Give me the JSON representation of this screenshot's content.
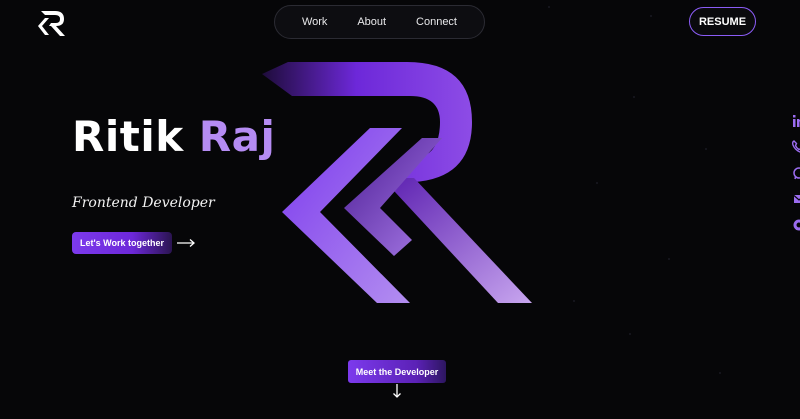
{
  "nav": {
    "links": [
      "Work",
      "About",
      "Connect"
    ],
    "resume_label": "RESUME"
  },
  "hero": {
    "first_name": "Ritik",
    "last_name": "Raj",
    "role": "Frontend Developer",
    "cta_label": "Let's Work together"
  },
  "meet_label": "Meet the Developer",
  "social_icons": [
    "linkedin-icon",
    "phone-icon",
    "whatsapp-icon",
    "mail-icon",
    "github-icon"
  ],
  "colors": {
    "background": "#060608",
    "accent": "#8b5cf6",
    "accent_light": "#b58cf3",
    "accent_dark": "#6d28d9"
  }
}
